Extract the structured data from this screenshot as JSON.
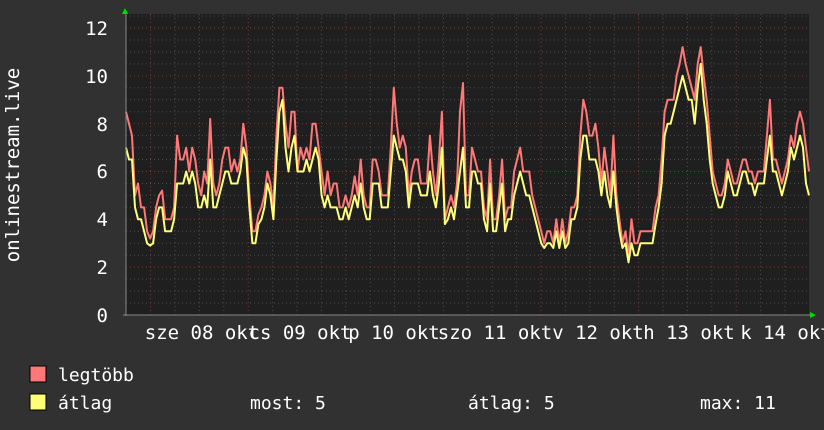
{
  "chart_data": {
    "type": "line",
    "ylabel": "onlinestream.live",
    "ylim": [
      0,
      12
    ],
    "yticks": [
      "0",
      "2",
      "4",
      "6",
      "8",
      "10",
      "12"
    ],
    "xticks": [
      "sze 08 okt",
      "cs 09 okt",
      "p 10 okt",
      "szo 11 okt",
      "v 12 okt",
      "h 13 okt",
      "k 14 okt"
    ],
    "grid": true,
    "series": [
      {
        "name": "legtöbb",
        "color": "#ff7777",
        "values": [
          8.5,
          8,
          7.5,
          5,
          5.5,
          4.5,
          4.5,
          3.5,
          3.2,
          3.5,
          4.5,
          5,
          5.2,
          4,
          4,
          4,
          4.5,
          7.5,
          6.5,
          6.5,
          7,
          6,
          7,
          6.5,
          5.5,
          5,
          6,
          5.5,
          8.2,
          5.5,
          5,
          5.5,
          6.5,
          7,
          7,
          6,
          6.5,
          6,
          6.5,
          8,
          7,
          5,
          3.5,
          3.5,
          4.2,
          4.5,
          5,
          6,
          5.5,
          4.5,
          7.5,
          9.5,
          9.5,
          8,
          7,
          8.5,
          8.5,
          6,
          7,
          6.5,
          7,
          6.5,
          8,
          8,
          7,
          6,
          5,
          6,
          5,
          5.5,
          5.5,
          4.5,
          4.5,
          5,
          4.5,
          5,
          5.8,
          5,
          6.5,
          5,
          4.5,
          4.5,
          6.5,
          6.5,
          6,
          5,
          5,
          5,
          7,
          9.5,
          8,
          7,
          7.5,
          7,
          5,
          6,
          6.5,
          6.5,
          5.5,
          5.5,
          5.5,
          7.5,
          6,
          5,
          6.5,
          8.5,
          4,
          4.5,
          5,
          4.5,
          5.5,
          8.5,
          9.7,
          5,
          5,
          7,
          6.5,
          6,
          6,
          4.5,
          4,
          6.5,
          4,
          4,
          5,
          6.5,
          4,
          4.5,
          4.5,
          6,
          6.5,
          7,
          6,
          6,
          6,
          5,
          4.5,
          4,
          3.5,
          3,
          3.5,
          3.5,
          3,
          4,
          3,
          4,
          3,
          3.5,
          4.5,
          4.5,
          5,
          7.5,
          9,
          8.5,
          7.5,
          7.5,
          8,
          7,
          5.5,
          7,
          6,
          5,
          7.5,
          5,
          4,
          3,
          3.5,
          2.5,
          4,
          3,
          3,
          3.5,
          3.5,
          3.5,
          3.5,
          3.5,
          4.5,
          5,
          6.5,
          8.5,
          9,
          9,
          9,
          10,
          10.5,
          11.2,
          10.5,
          10,
          9.5,
          9,
          10.5,
          11.2,
          10,
          9,
          7.5,
          6,
          5.5,
          5,
          5,
          5.5,
          6.5,
          6,
          5.5,
          5.5,
          6,
          6.5,
          6.5,
          6,
          6,
          5.5,
          6,
          6,
          6,
          7.5,
          9,
          6.5,
          6.5,
          6,
          5.5,
          6,
          6.5,
          7.5,
          7,
          8,
          8.5,
          8,
          7,
          6
        ]
      },
      {
        "name": "átlag",
        "color": "#ffff77",
        "values": [
          7,
          6.5,
          6.5,
          4.5,
          4,
          4,
          3.5,
          3,
          2.9,
          3,
          4,
          4.5,
          4.5,
          3.5,
          3.5,
          3.5,
          4,
          5.5,
          5.5,
          5.5,
          6,
          5.5,
          6,
          5.5,
          4.5,
          4.5,
          5,
          4.5,
          6.5,
          4.5,
          4.5,
          5,
          5.5,
          6,
          6,
          5.5,
          5.5,
          5.5,
          6,
          7,
          6.5,
          4.5,
          3,
          3,
          3.8,
          4,
          4.5,
          5.5,
          5,
          4,
          6.5,
          8.5,
          9,
          7,
          6,
          7,
          7.5,
          6,
          6,
          6,
          6.5,
          6,
          6.5,
          7,
          6.5,
          5,
          4.5,
          5,
          4.5,
          4.5,
          4.5,
          4,
          4,
          4.5,
          4,
          4.5,
          5,
          4.5,
          5.5,
          4.5,
          4,
          4,
          5.5,
          5.5,
          5.5,
          4.5,
          4.5,
          4.5,
          6,
          7.5,
          7,
          6.5,
          6.5,
          6,
          4.5,
          5.5,
          5.5,
          5.5,
          5,
          5,
          5,
          6,
          5,
          4.5,
          5.5,
          7,
          3.8,
          4,
          4.5,
          4,
          5,
          6,
          7,
          4.5,
          4.5,
          6,
          6,
          5.5,
          5.5,
          4,
          3.5,
          5.5,
          3.5,
          3.5,
          4.5,
          5.5,
          3.5,
          4,
          4,
          5,
          5.5,
          6,
          5.5,
          5,
          5,
          4.5,
          4,
          3.5,
          3,
          2.8,
          3,
          3,
          2.8,
          3.5,
          2.8,
          3.5,
          2.8,
          3,
          4,
          4,
          4.5,
          6.5,
          7.5,
          7.5,
          6.5,
          6.5,
          6.5,
          6,
          5,
          6,
          5,
          4.5,
          6,
          4.5,
          3.5,
          2.8,
          3,
          2.2,
          3,
          2.5,
          2.5,
          3,
          3,
          3,
          3,
          3,
          3.8,
          4.5,
          5.5,
          7.5,
          8,
          8,
          8.5,
          9,
          9.5,
          10,
          9.5,
          9,
          9,
          8,
          9.5,
          10.5,
          9,
          8,
          6.5,
          5.5,
          5,
          4.5,
          4.5,
          5,
          6,
          5.5,
          5,
          5,
          5.5,
          6,
          6,
          5.5,
          5.5,
          5,
          5.5,
          5.5,
          5.5,
          6.5,
          7.5,
          6,
          6,
          5.5,
          5,
          5.5,
          6,
          7,
          6.5,
          7,
          7.5,
          7,
          5.5,
          5
        ]
      }
    ],
    "legend": {
      "placement": "bottom-left",
      "items": [
        "legtöbb",
        "átlag"
      ],
      "stats": {
        "now": "most: 5",
        "avg": "átlag: 5",
        "max": "max: 11"
      }
    }
  }
}
